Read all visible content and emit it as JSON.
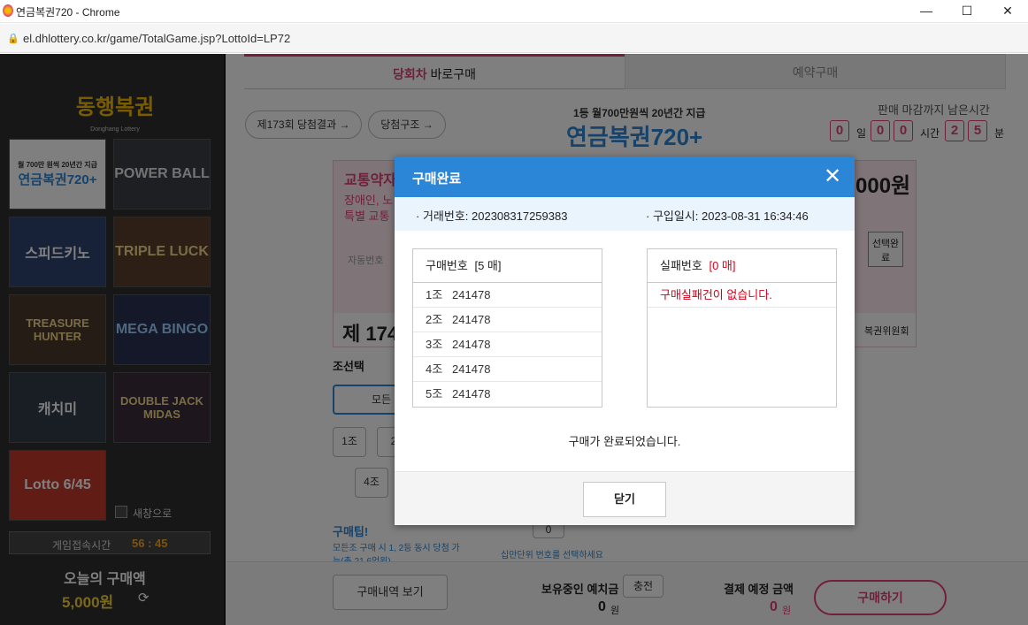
{
  "window": {
    "title": "연금복권720 - Chrome",
    "url": "el.dhlottery.co.kr/game/TotalGame.jsp?LottoId=LP72"
  },
  "sidebar": {
    "logo": "동행복권",
    "logo_sub": "Donghang Lottery",
    "games": [
      "연금복권720+",
      "POWER BALL",
      "스피드키노",
      "TRIPLE LUCK",
      "TREASURE HUNTER",
      "MEGA BINGO",
      "캐치미",
      "DOUBLE JACK MIDAS",
      "Lotto 6/45"
    ],
    "lotto720_tag": "월 700만 원씩 20년간 지급",
    "new_window_label": "새창으로",
    "session_label": "게임접속시간",
    "session_time": "56 : 45",
    "today_label": "오늘의 구매액",
    "today_amount": "5,000원"
  },
  "main": {
    "tab_current": "당회차 바로구매",
    "tab_current_prefix": "당회차",
    "tab_current_suffix": "바로구매",
    "tab_reserve": "예약구매",
    "result_btn": "제173회 당첨결과 →",
    "structure_btn": "당첨구조 →",
    "promo_line1": "1등 월700만원씩 20년간 지급",
    "promo_logo": "연금복권720+",
    "deadline_label": "판매 마감까지 남은시간",
    "deadline_days": "0",
    "deadline_hours": [
      "0",
      "0"
    ],
    "deadline_mins": [
      "2",
      "5"
    ],
    "unit_day": "일",
    "unit_hour": "시간",
    "unit_min": "분",
    "ticket_title": "교통약자",
    "ticket_text1": "장애인, 노",
    "ticket_text2": "특별 교통",
    "ticket_auto": "자동번호",
    "ticket_round": "제 174",
    "ticket_price": "000원",
    "select_done": "선택완료",
    "committee": "복권위원회",
    "group_label": "조선택",
    "group_all": "모든",
    "group1": "1조",
    "group2": "2",
    "group4": "4조",
    "zero_digit": "0",
    "tip_title": "구매팁!",
    "tip_text": "모든조 구매 시 1, 2등 동시 당첨 가능(총 21.6억원)",
    "tip_right": "십만단위 번호를 선택하세요",
    "history_btn": "구매내역 보기",
    "deposit_label": "보유중인 예치금",
    "charge_btn": "충전",
    "deposit_amount": "0",
    "won": "원",
    "pay_label": "결제 예정 금액",
    "pay_amount": "0",
    "buy_btn": "구매하기"
  },
  "modal": {
    "title": "구매완료",
    "tx_label": "· 거래번호: 202308317259383",
    "date_label": "· 구입일시: 2023-08-31 16:34:46",
    "bought_header": "구매번호",
    "bought_count": "[5 매]",
    "bought": [
      {
        "group": "1조",
        "number": "241478"
      },
      {
        "group": "2조",
        "number": "241478"
      },
      {
        "group": "3조",
        "number": "241478"
      },
      {
        "group": "4조",
        "number": "241478"
      },
      {
        "group": "5조",
        "number": "241478"
      }
    ],
    "failed_header": "실패번호",
    "failed_count": "[0 매]",
    "failed_msg": "구매실패건이 없습니다.",
    "done_msg": "구매가 완료되었습니다.",
    "close_btn": "닫기"
  },
  "colors": {
    "accent": "#e0407a",
    "header_blue": "#2b86d8",
    "error_red": "#d0021b"
  }
}
